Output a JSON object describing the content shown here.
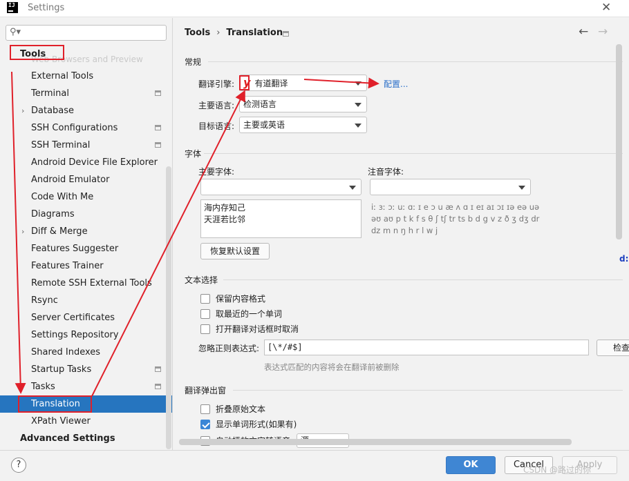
{
  "window": {
    "title": "Settings",
    "close_icon": "close-icon"
  },
  "search": {
    "placeholder": "",
    "value": ""
  },
  "tree": {
    "ghost_text": "Web Browsers and Preview",
    "items": [
      {
        "label": "Tools",
        "level": "top"
      },
      {
        "label": "External Tools"
      },
      {
        "label": "Terminal",
        "pinned": true
      },
      {
        "label": "Database",
        "expandable": true
      },
      {
        "label": "SSH Configurations",
        "pinned": true
      },
      {
        "label": "SSH Terminal",
        "pinned": true
      },
      {
        "label": "Android Device File Explorer"
      },
      {
        "label": "Android Emulator"
      },
      {
        "label": "Code With Me"
      },
      {
        "label": "Diagrams"
      },
      {
        "label": "Diff & Merge",
        "expandable": true
      },
      {
        "label": "Features Suggester"
      },
      {
        "label": "Features Trainer"
      },
      {
        "label": "Remote SSH External Tools"
      },
      {
        "label": "Rsync"
      },
      {
        "label": "Server Certificates"
      },
      {
        "label": "Settings Repository"
      },
      {
        "label": "Shared Indexes"
      },
      {
        "label": "Startup Tasks",
        "pinned": true
      },
      {
        "label": "Tasks",
        "expandable": true,
        "pinned": true
      },
      {
        "label": "Translation",
        "selected": true
      },
      {
        "label": "XPath Viewer"
      },
      {
        "label": "Advanced Settings",
        "level": "top"
      }
    ]
  },
  "breadcrumb": {
    "parent": "Tools",
    "separator": "›",
    "current": "Translation"
  },
  "nav": {
    "back": "←",
    "forward": "→"
  },
  "general": {
    "header": "常规",
    "engine_label": "翻译引擎:",
    "engine_logo": "y",
    "engine_value": "有道翻译",
    "configure_link": "配置...",
    "primary_lang_label": "主要语言:",
    "primary_lang_value": "检测语言",
    "target_lang_label": "目标语言:",
    "target_lang_value": "主要或英语"
  },
  "fonts": {
    "header": "字体",
    "primary_label": "主要字体:",
    "primary_value": "",
    "phonetic_label": "注音字体:",
    "phonetic_value": "",
    "preview_line1": "海内存知己",
    "preview_line2": "天涯若比邻",
    "phonetic_preview": "iː ɜː ɔː uː ɑː ɪ e ɔ u æ ʌ ɑ ɪ eɪ aɪ ɔɪ ɪə eə uə əʊ aʊ p t k f s θ ʃ tʃ tr ts b d g v z ð ʒ dʒ dr dz m n ŋ h r l w j",
    "reset_button": "恢复默认设置"
  },
  "text_selection": {
    "header": "文本选择",
    "keep_format": {
      "label": "保留内容格式",
      "checked": false
    },
    "nearest_word": {
      "label": "取最近的一个单词",
      "checked": false
    },
    "cancel_on_open": {
      "label": "打开翻译对话框时取消",
      "checked": false
    },
    "regex_label": "忽略正则表达式:",
    "regex_value": "[\\*/#$]",
    "check_button": "检查",
    "regex_hint": "表达式匹配的内容将会在翻译前被删除"
  },
  "popup": {
    "header": "翻译弹出窗",
    "fold_original": {
      "label": "折叠原始文本",
      "checked": false
    },
    "show_word_forms": {
      "label": "显示单词形式(如果有)",
      "checked": true
    },
    "auto_tts": {
      "label": "自动播放文字转语音:",
      "checked": false
    },
    "tts_source": "源"
  },
  "buttons": {
    "help": "?",
    "ok": "OK",
    "cancel": "Cancel",
    "apply": "Apply"
  },
  "watermark": "CSDN @路过的你",
  "edge_artifact": "d:",
  "colors": {
    "selection": "#2675bf",
    "ok_button": "#3f86d3",
    "annotation": "#e0202a",
    "link": "#2a6fc9"
  }
}
